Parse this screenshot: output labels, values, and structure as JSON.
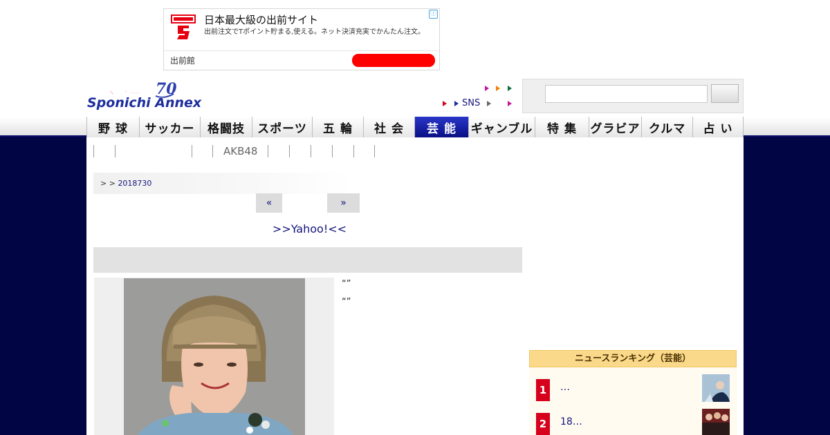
{
  "ad": {
    "title": "日本最大級の出前サイト",
    "description": "出前注文でTポイント貯まる,使える。ネット決済充実でかんたん注文。",
    "brand": "出前館",
    "info_icon": "ⓘ",
    "cta_color": "#ff0000"
  },
  "header": {
    "sns_label": "SNS",
    "logo_alt": "Sponichi Annex"
  },
  "nav": {
    "items": [
      {
        "label": "野 球"
      },
      {
        "label": "サッカー"
      },
      {
        "label": "格闘技"
      },
      {
        "label": "スポーツ"
      },
      {
        "label": "五 輪"
      },
      {
        "label": "社 会"
      },
      {
        "label": "芸 能",
        "active": true
      },
      {
        "label": "ギャンブル"
      },
      {
        "label": "特 集"
      },
      {
        "label": "グラビア"
      },
      {
        "label": "クルマ"
      },
      {
        "label": "占 い"
      }
    ]
  },
  "subnav": {
    "akb_label": "AKB48"
  },
  "breadcrumb": {
    "prefix": ">  ",
    "arrow": "> ",
    "date_link": "2018730"
  },
  "pager": {
    "prev": "«",
    "next": "»"
  },
  "article": {
    "yahoo_link": ">>Yahoo!<<",
    "quote1": "“”",
    "quote2": "“”"
  },
  "ranking": {
    "title": "ニュースランキング（芸能）",
    "items": [
      {
        "rank": "1",
        "text": "…"
      },
      {
        "rank": "2",
        "text": "18…"
      }
    ]
  },
  "colors": {
    "navy": "#020544",
    "active_nav": "#080f85",
    "rank_red": "#d6001c",
    "link": "#13137a"
  }
}
